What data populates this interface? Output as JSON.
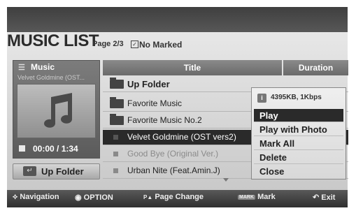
{
  "header": {
    "title": "MUSIC LIST",
    "page": "Page 2/3",
    "marked": "No Marked"
  },
  "now_playing": {
    "section_label": "Music",
    "file": "Velvet Goldmine (OST...",
    "time": "00:00 / 1:34",
    "up_folder_label": "Up Folder"
  },
  "list": {
    "col_title": "Title",
    "col_duration": "Duration",
    "rows": [
      {
        "label": "Up Folder"
      },
      {
        "label": "Favorite Music"
      },
      {
        "label": "Favorite Music No.2"
      },
      {
        "label": "Velvet Goldmine (OST vers2)"
      },
      {
        "label": "Good Bye (Original Ver.)"
      },
      {
        "label": "Urban Nite (Feat.Amin.J)"
      }
    ]
  },
  "menu": {
    "info": "4395KB, 1Kbps",
    "items": [
      "Play",
      "Play with Photo",
      "Mark All",
      "Delete",
      "Close"
    ]
  },
  "footer": {
    "navigation": "Navigation",
    "option": "OPTION",
    "page_change": "Page Change",
    "mark_badge": "MARK",
    "mark": "Mark",
    "exit": "Exit"
  }
}
